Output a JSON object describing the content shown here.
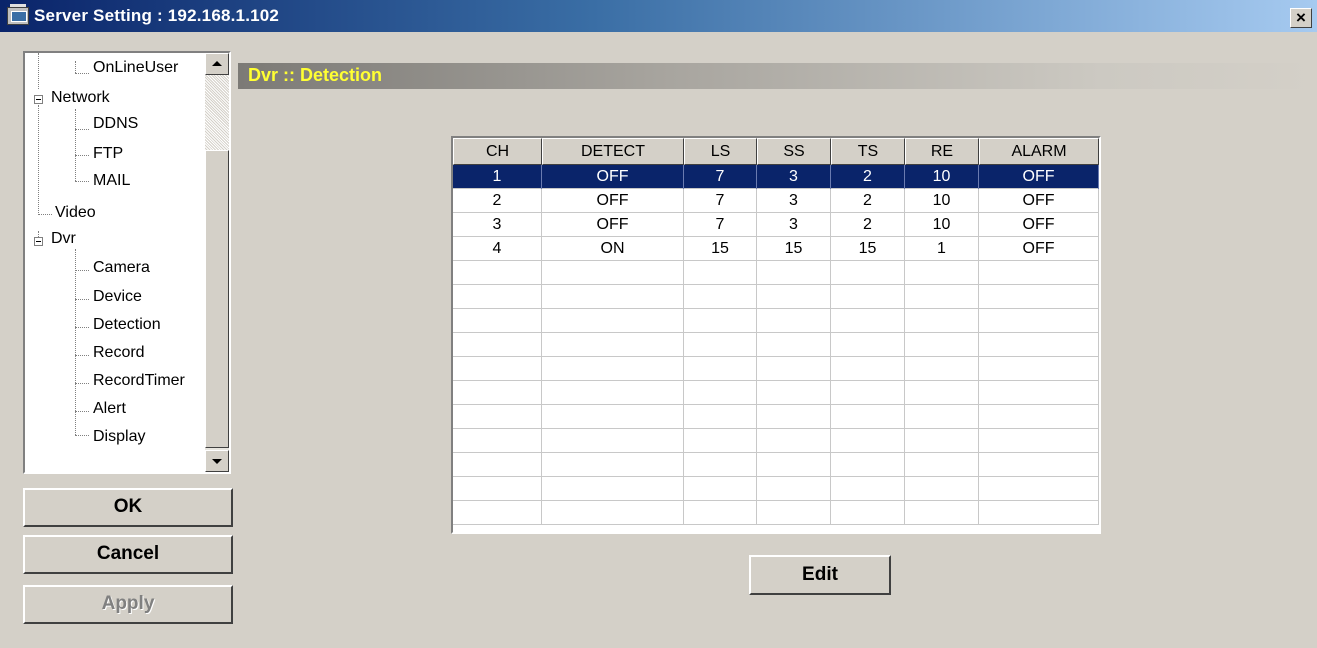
{
  "window": {
    "title": "Server Setting : 192.168.1.102",
    "close_label": "×"
  },
  "tree": {
    "items": [
      {
        "label": "OnLineUser"
      },
      {
        "label": "Network"
      },
      {
        "label": "DDNS"
      },
      {
        "label": "FTP"
      },
      {
        "label": "MAIL"
      },
      {
        "label": "Video"
      },
      {
        "label": "Dvr"
      },
      {
        "label": "Camera"
      },
      {
        "label": "Device"
      },
      {
        "label": "Detection"
      },
      {
        "label": "Record"
      },
      {
        "label": "RecordTimer"
      },
      {
        "label": "Alert"
      },
      {
        "label": "Display"
      }
    ]
  },
  "buttons": {
    "ok": "OK",
    "cancel": "Cancel",
    "apply": "Apply",
    "edit": "Edit"
  },
  "section": {
    "title": "Dvr :: Detection"
  },
  "table": {
    "columns": [
      "CH",
      "DETECT",
      "LS",
      "SS",
      "TS",
      "RE",
      "ALARM"
    ],
    "rows": [
      [
        "1",
        "OFF",
        "7",
        "3",
        "2",
        "10",
        "OFF"
      ],
      [
        "2",
        "OFF",
        "7",
        "3",
        "2",
        "10",
        "OFF"
      ],
      [
        "3",
        "OFF",
        "7",
        "3",
        "2",
        "10",
        "OFF"
      ],
      [
        "4",
        "ON",
        "15",
        "15",
        "15",
        "1",
        "OFF"
      ]
    ],
    "selected_row": 0
  },
  "colors": {
    "selection": "#0a246a",
    "section_title": "#ffff33",
    "face": "#d4d0c8"
  }
}
